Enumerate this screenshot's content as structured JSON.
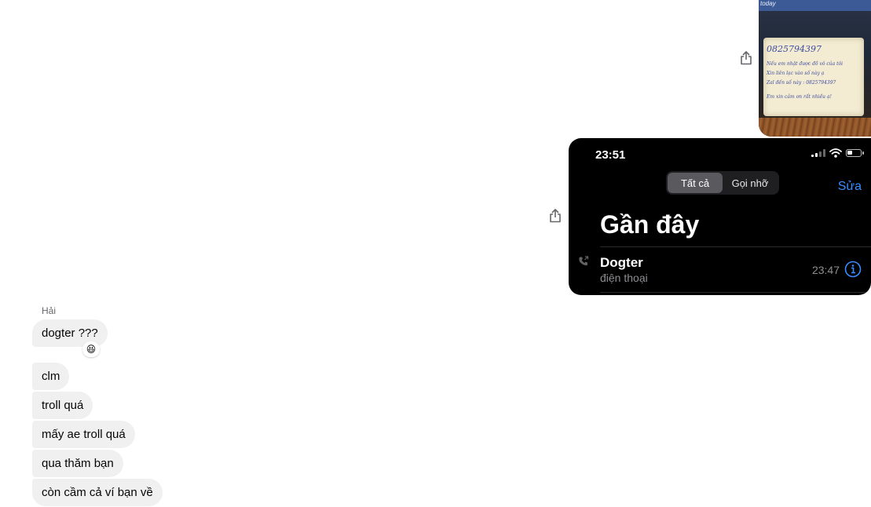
{
  "outgoing": {
    "note_photo": {
      "top_label": "today",
      "lines": [
        "0825794397",
        "Nếu em nhặt được đồ vô của tôi",
        "Xin liên lạc vào số này ạ",
        "Zal đến số này : 0825794397",
        "Em xin cảm ơn rất nhiều ạ!"
      ]
    },
    "phone_screenshot": {
      "time": "23:51",
      "segments": [
        "Tất cả",
        "Gọi nhỡ"
      ],
      "active_segment": 0,
      "edit_label": "Sửa",
      "title": "Gần đây",
      "call": {
        "name": "Dogter",
        "type": "điện thoại",
        "time": "23:47"
      }
    }
  },
  "incoming": {
    "sender": "Hải",
    "messages": [
      "dogter ???",
      "clm",
      "troll quá",
      "mấy ae troll quá",
      "qua thăm bạn",
      "còn cầm cả ví bạn về"
    ],
    "reaction_emoji": "😆"
  },
  "colors": {
    "bubble_bg": "#f0f0f0",
    "ios_accent": "#3a8cff",
    "ios_secondary": "#8e8e93"
  },
  "icons": {
    "share": "share-icon",
    "phone": "phone-call-icon",
    "info": "info-icon",
    "wifi": "wifi-icon",
    "battery": "battery-icon",
    "signal": "cellular-signal-icon"
  }
}
